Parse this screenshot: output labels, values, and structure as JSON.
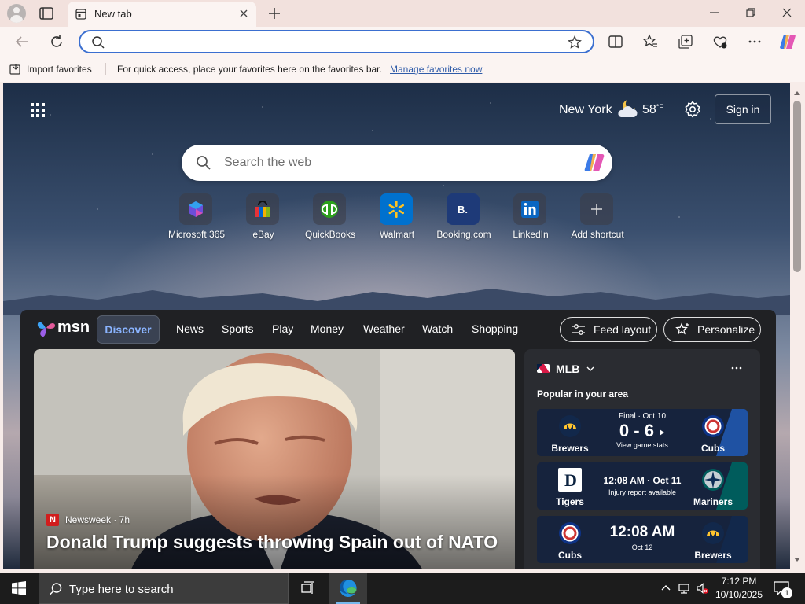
{
  "browser": {
    "tab_title": "New tab",
    "address_value": "",
    "favorites_bar": {
      "import_label": "Import favorites",
      "message": "For quick access, place your favorites here on the favorites bar.",
      "manage_link": "Manage favorites now"
    }
  },
  "newtab": {
    "weather": {
      "city": "New York",
      "temp": "58",
      "unit": "°F"
    },
    "sign_in_label": "Sign in",
    "search_placeholder": "Search the web",
    "shortcuts": [
      {
        "label": "Microsoft 365",
        "icon": "microsoft-365-icon"
      },
      {
        "label": "eBay",
        "icon": "ebay-icon"
      },
      {
        "label": "QuickBooks",
        "icon": "quickbooks-icon"
      },
      {
        "label": "Walmart",
        "icon": "walmart-icon"
      },
      {
        "label": "Booking.com",
        "icon": "booking-icon"
      },
      {
        "label": "LinkedIn",
        "icon": "linkedin-icon"
      },
      {
        "label": "Add shortcut",
        "icon": "plus-icon"
      }
    ]
  },
  "feed": {
    "logo_text": "msn",
    "tabs": [
      "Discover",
      "News",
      "Sports",
      "Play",
      "Money",
      "Weather",
      "Watch",
      "Shopping"
    ],
    "feed_layout_label": "Feed layout",
    "personalize_label": "Personalize",
    "hero": {
      "source_logo_letter": "N",
      "source": "Newsweek · 7h",
      "title": "Donald Trump suggests throwing Spain out of NATO"
    },
    "sports": {
      "league": "MLB",
      "subtitle": "Popular in your area",
      "games": [
        {
          "away": "Brewers",
          "home": "Cubs",
          "status": "Final · Oct 10",
          "score": "0 - 6",
          "note": "View game stats"
        },
        {
          "away": "Tigers",
          "home": "Mariners",
          "time": "12:08 AM · Oct 11",
          "note": "Injury report available"
        },
        {
          "away": "Cubs",
          "home": "Brewers",
          "time": "12:08 AM",
          "note": "Oct 12"
        }
      ]
    }
  },
  "taskbar": {
    "search_placeholder": "Type here to search",
    "time": "7:12 PM",
    "date": "10/10/2025",
    "notification_count": "1"
  },
  "colors": {
    "accent": "#3b6fd0",
    "feed_bg": "#202124",
    "msn_active": "#8ab4ff",
    "taskbar": "#1c1c1c"
  }
}
